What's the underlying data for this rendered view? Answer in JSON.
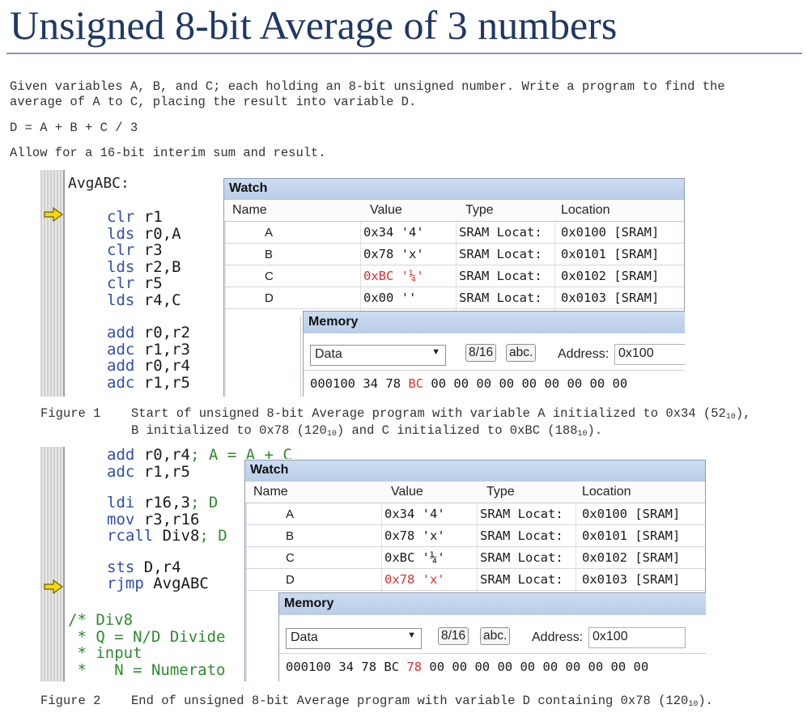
{
  "title": "Unsigned 8-bit Average of 3 numbers",
  "intro": {
    "line1": "Given variables A, B, and C; each holding an 8-bit unsigned number. Write a program to find the",
    "line2": "average of A to C, placing the result into variable D.",
    "formula": "D = A + B + C / 3",
    "allow": "Allow for a 16-bit interim sum and result."
  },
  "figure1": {
    "label": "AvgABC:",
    "code": [
      {
        "op": "clr",
        "args": "r1"
      },
      {
        "op": "lds",
        "args": "r0,A"
      },
      {
        "op": "clr",
        "args": "r3"
      },
      {
        "op": "lds",
        "args": "r2,B"
      },
      {
        "op": "clr",
        "args": "r5"
      },
      {
        "op": "lds",
        "args": "r4,C"
      },
      {
        "op": "add",
        "args": "r0,r2"
      },
      {
        "op": "adc",
        "args": "r1,r3"
      },
      {
        "op": "add",
        "args": "r0,r4"
      },
      {
        "op": "adc",
        "args": "r1,r5"
      }
    ],
    "watch": {
      "title": "Watch",
      "headers": [
        "Name",
        "Value",
        "Type",
        "Location"
      ],
      "rows": [
        {
          "name": "A",
          "value": "0x34 '4'",
          "type": "SRAM Locat:",
          "location": "0x0100 [SRAM]",
          "changed": false
        },
        {
          "name": "B",
          "value": "0x78 'x'",
          "type": "SRAM Locat:",
          "location": "0x0101 [SRAM]",
          "changed": false
        },
        {
          "name": "C",
          "value": "0xBC '¼'",
          "type": "SRAM Locat:",
          "location": "0x0102 [SRAM]",
          "changed": true
        },
        {
          "name": "D",
          "value": "0x00 ''",
          "type": "SRAM Locat:",
          "location": "0x0103 [SRAM]",
          "changed": false
        }
      ]
    },
    "memory": {
      "title": "Memory",
      "space": "Data",
      "btn_bits": "8/16",
      "btn_abc": "abc.",
      "address_label": "Address:",
      "address": "0x100",
      "row_addr": "000100",
      "bytes": [
        "34",
        "78",
        "BC",
        "00",
        "00",
        "00",
        "00",
        "00",
        "00",
        "00",
        "00",
        "00"
      ],
      "changed_index": 2
    },
    "caption_num": "Figure 1",
    "caption_line1": "Start of unsigned 8-bit Average program with variable A initialized to 0x34 (52",
    "caption_line1_sub": "10",
    "caption_line1_end": "),",
    "caption_line2_a": "B initialized to 0x78 (120",
    "caption_line2_sub1": "10",
    "caption_line2_b": ") and C initialized to 0xBC (188",
    "caption_line2_sub2": "10",
    "caption_line2_c": ")."
  },
  "figure2": {
    "code": [
      {
        "op": "add",
        "args": "r0,r4",
        "cm": "; A = A + C"
      },
      {
        "op": "adc",
        "args": "r1,r5",
        "cm": ""
      },
      {
        "op": "ldi",
        "args": "r16,3",
        "cm": "; D"
      },
      {
        "op": "mov",
        "args": "r3,r16",
        "cm": ""
      },
      {
        "op": "rcall",
        "args": "Div8",
        "cm": "; D"
      },
      {
        "op": "sts",
        "args": "D,r4",
        "cm": ""
      },
      {
        "op": "rjmp",
        "args": "AvgABC",
        "cm": ""
      }
    ],
    "comment_lines": [
      "/* Div8",
      " * Q = N/D Divide",
      " * input",
      " *   N = Numerato"
    ],
    "watch": {
      "title": "Watch",
      "headers": [
        "Name",
        "Value",
        "Type",
        "Location"
      ],
      "rows": [
        {
          "name": "A",
          "value": "0x34 '4'",
          "type": "SRAM Locat:",
          "location": "0x0100 [SRAM]",
          "changed": false
        },
        {
          "name": "B",
          "value": "0x78 'x'",
          "type": "SRAM Locat:",
          "location": "0x0101 [SRAM]",
          "changed": false
        },
        {
          "name": "C",
          "value": "0xBC '¼'",
          "type": "SRAM Locat:",
          "location": "0x0102 [SRAM]",
          "changed": false
        },
        {
          "name": "D",
          "value": "0x78 'x'",
          "type": "SRAM Locat:",
          "location": "0x0103 [SRAM]",
          "changed": true
        }
      ]
    },
    "memory": {
      "title": "Memory",
      "space": "Data",
      "btn_bits": "8/16",
      "btn_abc": "abc.",
      "address_label": "Address:",
      "address": "0x100",
      "row_addr": "000100",
      "bytes": [
        "34",
        "78",
        "BC",
        "78",
        "00",
        "00",
        "00",
        "00",
        "00",
        "00",
        "00",
        "00",
        "00",
        "00"
      ],
      "changed_index": 3
    },
    "caption_num": "Figure 2",
    "caption_a": "End of unsigned 8-bit Average program with variable D containing 0x78 (120",
    "caption_sub": "10",
    "caption_b": ")."
  },
  "colors": {
    "title": "#1f3864",
    "changed": "#e03030",
    "keyword": "#2d4fb0",
    "comment": "#2e8b2e",
    "arrow": "#f5d90a"
  }
}
